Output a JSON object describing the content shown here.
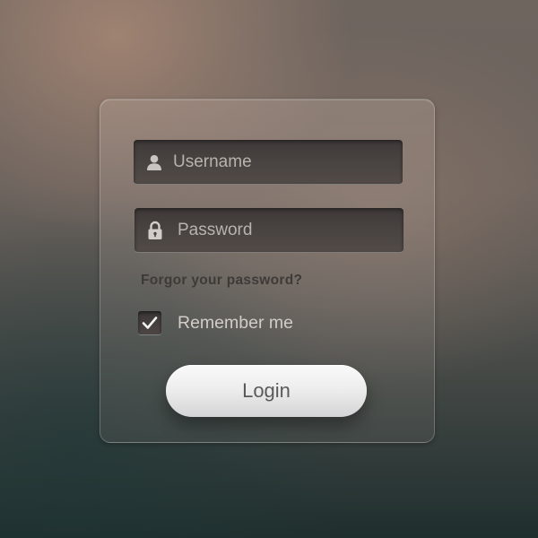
{
  "login_form": {
    "username": {
      "placeholder": "Username",
      "value": "",
      "icon": "user-icon"
    },
    "password": {
      "placeholder": "Password",
      "value": "",
      "icon": "lock-icon"
    },
    "forgot_link": "Forgor your password?",
    "remember": {
      "label": "Remember me",
      "checked": true,
      "icon": "checkmark-icon"
    },
    "login_button": "Login"
  },
  "colors": {
    "field_background": "#443e3c",
    "button_background": "#ececec",
    "link_text": "#3e3a38",
    "label_text": "#d2ccc7"
  }
}
